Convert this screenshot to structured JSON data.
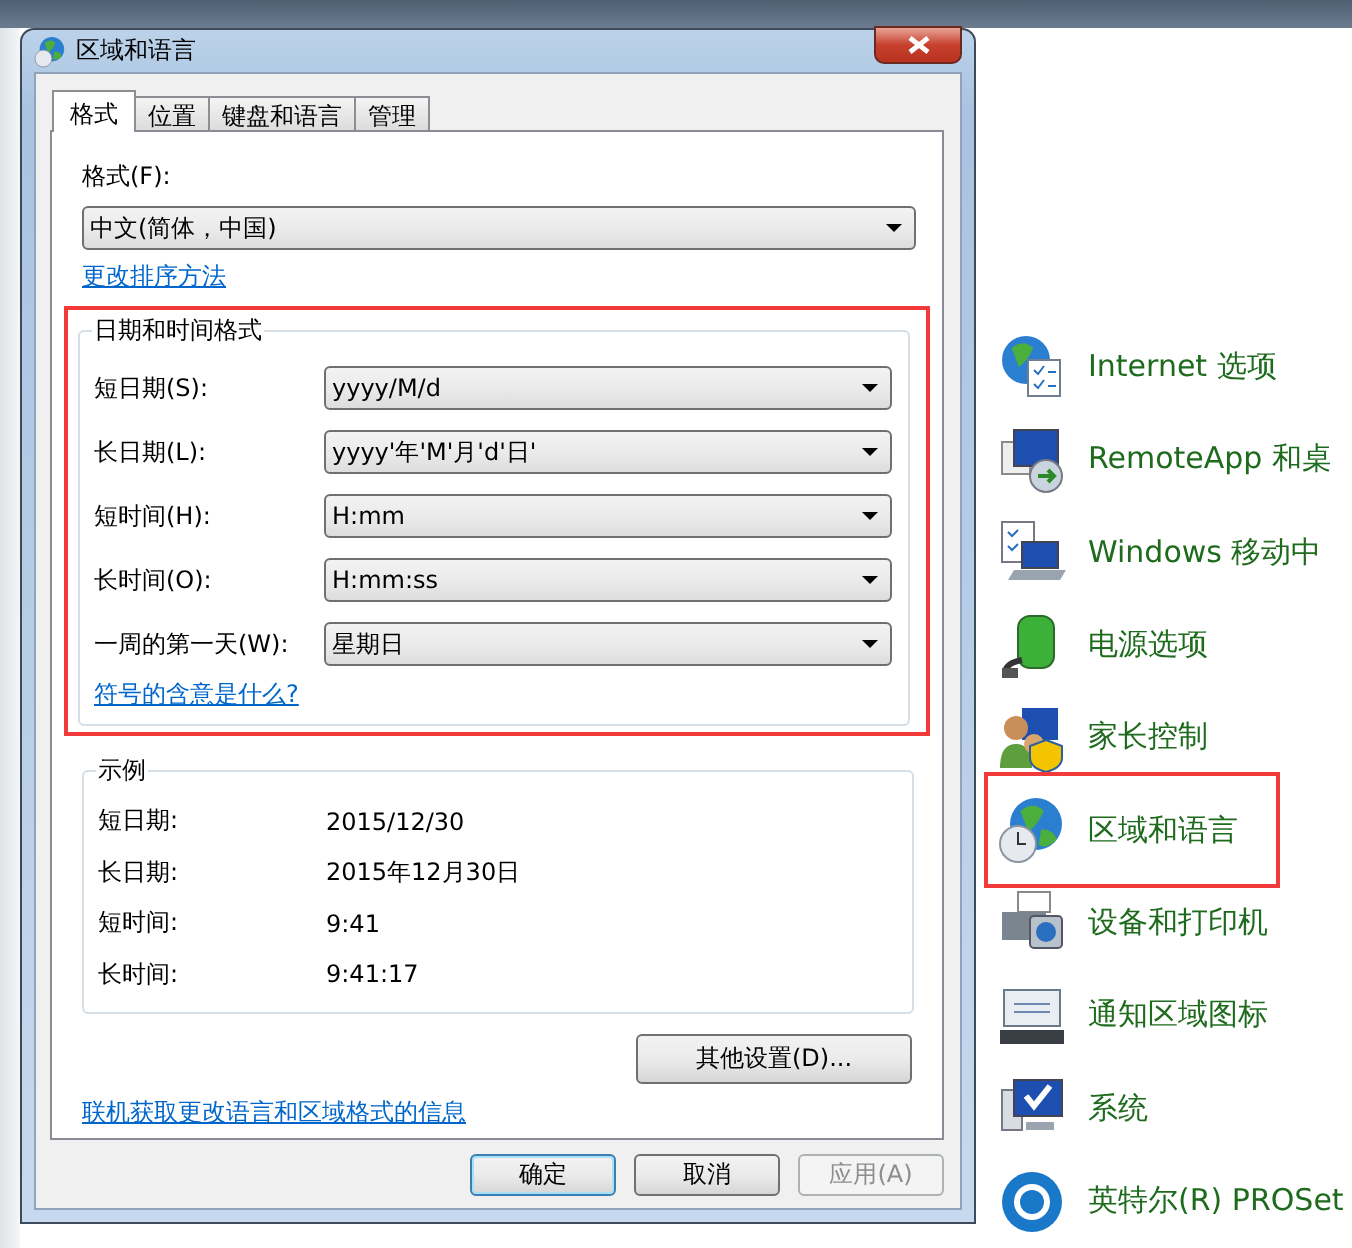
{
  "window": {
    "title": "区域和语言"
  },
  "tabs": [
    {
      "label": "格式",
      "selected": true
    },
    {
      "label": "位置",
      "selected": false
    },
    {
      "label": "键盘和语言",
      "selected": false
    },
    {
      "label": "管理",
      "selected": false
    }
  ],
  "format": {
    "label": "格式(F):",
    "value": "中文(简体，中国)",
    "link": "更改排序方法"
  },
  "date_time_formats": {
    "title": "日期和时间格式",
    "highlighted": true,
    "rows": [
      {
        "label": "短日期(S):",
        "value": "yyyy/M/d"
      },
      {
        "label": "长日期(L):",
        "value": "yyyy'年'M'月'd'日'"
      },
      {
        "label": "短时间(H):",
        "value": "H:mm"
      },
      {
        "label": "长时间(O):",
        "value": "H:mm:ss"
      },
      {
        "label": "一周的第一天(W):",
        "value": "星期日"
      }
    ],
    "link": "符号的含意是什么?"
  },
  "examples": {
    "title": "示例",
    "rows": [
      {
        "label": "短日期:",
        "value": "2015/12/30"
      },
      {
        "label": "长日期:",
        "value": "2015年12月30日"
      },
      {
        "label": "短时间:",
        "value": "9:41"
      },
      {
        "label": "长时间:",
        "value": "9:41:17"
      }
    ]
  },
  "other_settings_button": "其他设置(D)...",
  "online_link": "联机获取更改语言和区域格式的信息",
  "buttons": [
    {
      "label": "确定",
      "default": true,
      "disabled": false
    },
    {
      "label": "取消",
      "default": false,
      "disabled": false
    },
    {
      "label": "应用(A)",
      "default": false,
      "disabled": true
    }
  ],
  "control_panel_items": [
    {
      "label": "Internet 选项",
      "highlighted": false
    },
    {
      "label": "RemoteApp 和桌",
      "highlighted": false
    },
    {
      "label": "Windows 移动中",
      "highlighted": false
    },
    {
      "label": "电源选项",
      "highlighted": false
    },
    {
      "label": "家长控制",
      "highlighted": false
    },
    {
      "label": "区域和语言",
      "highlighted": true
    },
    {
      "label": "设备和打印机",
      "highlighted": false
    },
    {
      "label": "通知区域图标",
      "highlighted": false
    },
    {
      "label": "系统",
      "highlighted": false
    },
    {
      "label": "英特尔(R) PROSet",
      "highlighted": false
    }
  ]
}
